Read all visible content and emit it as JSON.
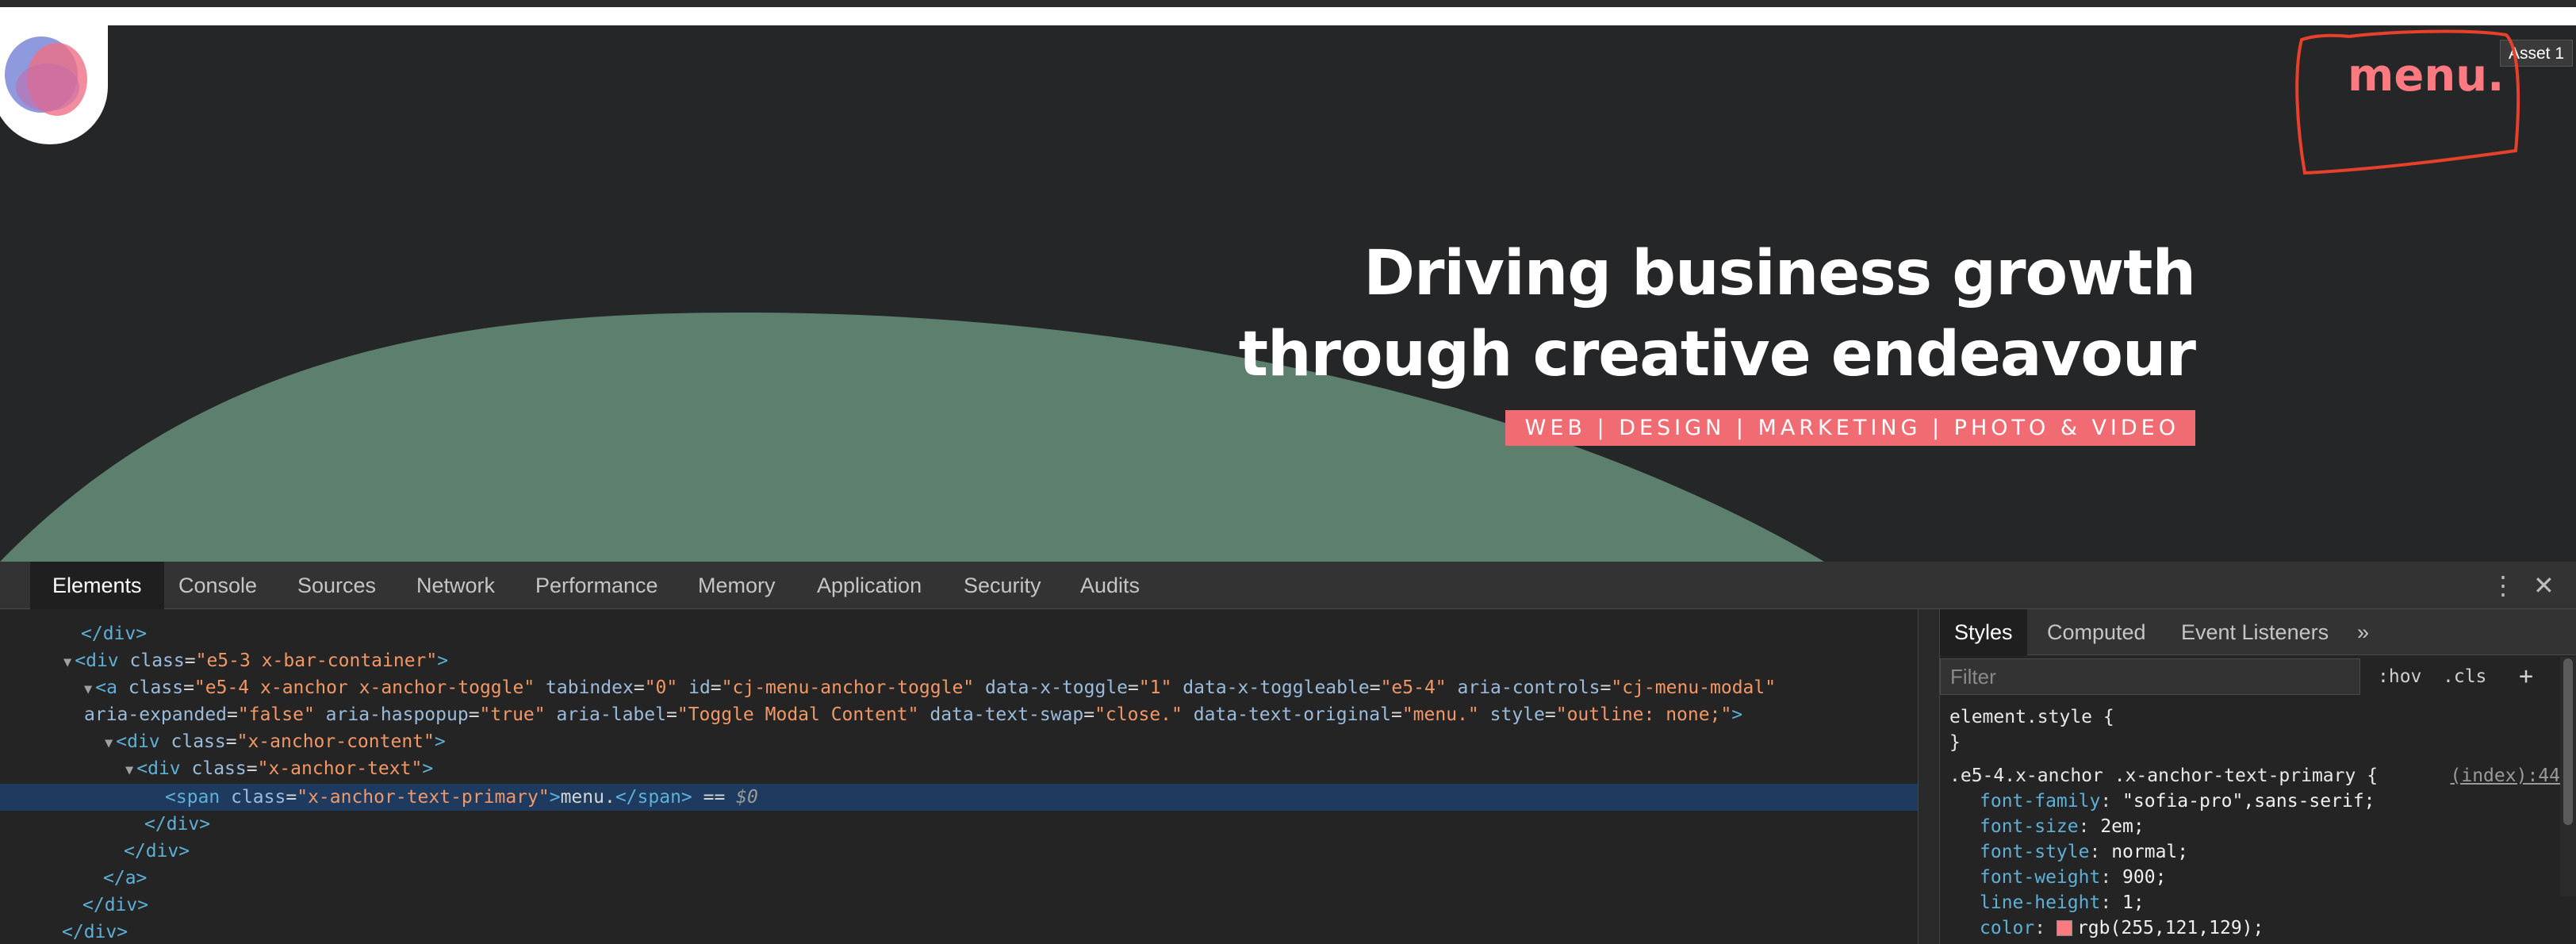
{
  "site": {
    "headline_line1": "Driving business growth",
    "headline_line2": "through creative endeavour",
    "tagline": "WEB | DESIGN | MARKETING | PHOTO & VIDEO",
    "menu_label": "menu.",
    "asset_tooltip": "Asset 1",
    "colors": {
      "background": "#252627",
      "hill": "#5d7f6e",
      "accent": "#f16c72",
      "menu": "#ff7981",
      "annotation": "#e8402b"
    }
  },
  "devtools": {
    "tabs": [
      "Elements",
      "Console",
      "Sources",
      "Network",
      "Performance",
      "Memory",
      "Application",
      "Security",
      "Audits"
    ],
    "active_tab": "Elements",
    "right_icons": [
      "more-vertical-icon",
      "close-icon"
    ],
    "dom": {
      "l0": "</div>",
      "l1_open": "<div",
      "l1_attr": "class",
      "l1_val": "\"e5-3 x-bar-container\"",
      "l1_close": ">",
      "l2": {
        "tag": "<a",
        "class_attr": "class",
        "class_val": "\"e5-4 x-anchor x-anchor-toggle\"",
        "tabindex_attr": "tabindex",
        "tabindex_val": "\"0\"",
        "id_attr": "id",
        "id_val": "\"cj-menu-anchor-toggle\"",
        "toggle_attr": "data-x-toggle",
        "toggle_val": "\"1\"",
        "toggleable_attr": "data-x-toggleable",
        "toggleable_val": "\"e5-4\"",
        "controls_attr": "aria-controls",
        "controls_val": "\"cj-menu-modal\""
      },
      "l3": {
        "expanded_attr": "aria-expanded",
        "expanded_val": "\"false\"",
        "haspopup_attr": "aria-haspopup",
        "haspopup_val": "\"true\"",
        "label_attr": "aria-label",
        "label_val": "\"Toggle Modal Content\"",
        "swap_attr": "data-text-swap",
        "swap_val": "\"close.\"",
        "original_attr": "data-text-original",
        "original_val": "\"menu.\"",
        "style_attr": "style",
        "style_val": "\"outline: none;\"",
        "close": ">"
      },
      "l4_open": "<div",
      "l4_attr": "class",
      "l4_val": "\"x-anchor-content\"",
      "l5_open": "<div",
      "l5_attr": "class",
      "l5_val": "\"x-anchor-text\"",
      "l6": {
        "open": "<span",
        "attr": "class",
        "val": "\"x-anchor-text-primary\"",
        "gt": ">",
        "text": "menu.",
        "close": "</span>",
        "eq": " == ",
        "dollar": "$0"
      },
      "l7": "</div>",
      "l8": "</div>",
      "l9": "</a>",
      "l10": "</div>",
      "l11": "</div>"
    },
    "styles": {
      "tabs": [
        "Styles",
        "Computed",
        "Event Listeners"
      ],
      "more_tabs": "»",
      "filter_placeholder": "Filter",
      "hov": ":hov",
      "cls": ".cls",
      "add": "+",
      "element_style": "element.style {",
      "element_style_close": "}",
      "rule_selector": ".e5-4.x-anchor .x-anchor-text-primary {",
      "rule_source": "(index):44",
      "declarations": [
        {
          "prop": "font-family",
          "value": "\"sofia-pro\",sans-serif;"
        },
        {
          "prop": "font-size",
          "value": "2em;"
        },
        {
          "prop": "font-style",
          "value": "normal;"
        },
        {
          "prop": "font-weight",
          "value": "900;"
        },
        {
          "prop": "line-height",
          "value": "1;"
        },
        {
          "prop": "color",
          "value": "rgb(255,121,129);"
        }
      ]
    }
  }
}
